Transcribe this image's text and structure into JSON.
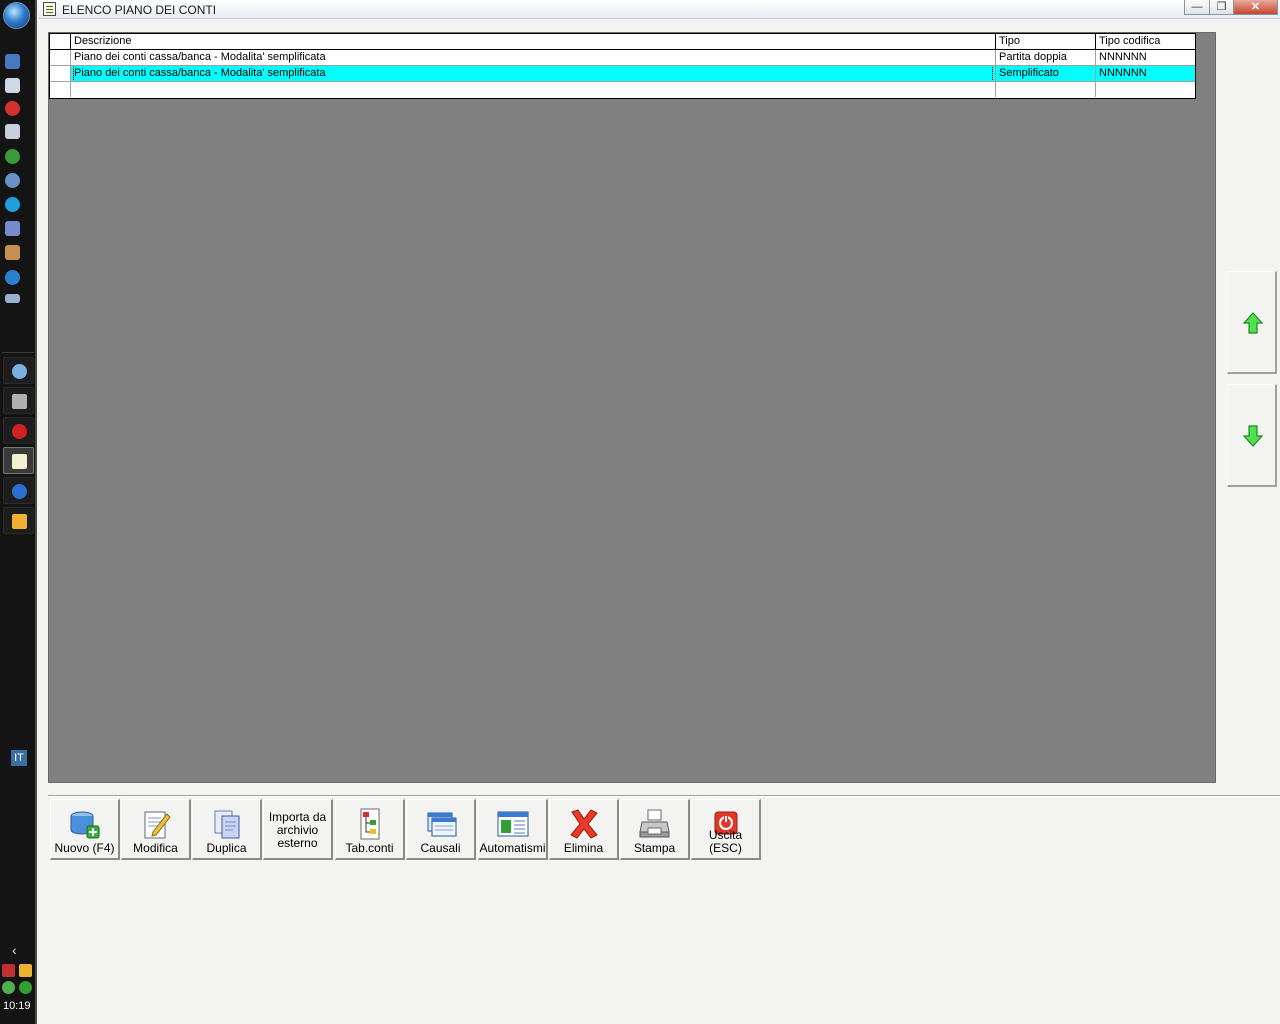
{
  "window": {
    "title": "ELENCO PIANO DEI CONTI",
    "controls": [
      "minimize",
      "restore",
      "close"
    ]
  },
  "grid": {
    "columns": [
      "Descrizione",
      "Tipo",
      "Tipo codifica"
    ],
    "rows": [
      {
        "descrizione": "Piano dei conti cassa/banca - Modalita' semplificata",
        "tipo": "Partita doppia",
        "tipo_codifica": "NNNNNN",
        "selected": false
      },
      {
        "descrizione": "Piano dei conti cassa/banca - Modalita' semplificata",
        "tipo": "Semplificato",
        "tipo_codifica": "NNNNNN",
        "selected": true
      },
      {
        "descrizione": "",
        "tipo": "",
        "tipo_codifica": "",
        "selected": false
      }
    ],
    "selection_color": "#00ffff"
  },
  "toolbar": {
    "nuovo": "Nuovo (F4)",
    "modifica": "Modifica",
    "duplica": "Duplica",
    "importa": "Importa da archivio esterno",
    "tab_conti": "Tab.conti",
    "causali": "Causali",
    "automatismi": "Automatismi",
    "elimina": "Elimina",
    "stampa": "Stampa",
    "uscita": "Uscita (ESC)"
  },
  "scroll": {
    "up_icon": "green-arrow-up-icon",
    "down_icon": "green-arrow-down-icon"
  },
  "taskbar": {
    "language": "IT",
    "clock": "10:19"
  }
}
